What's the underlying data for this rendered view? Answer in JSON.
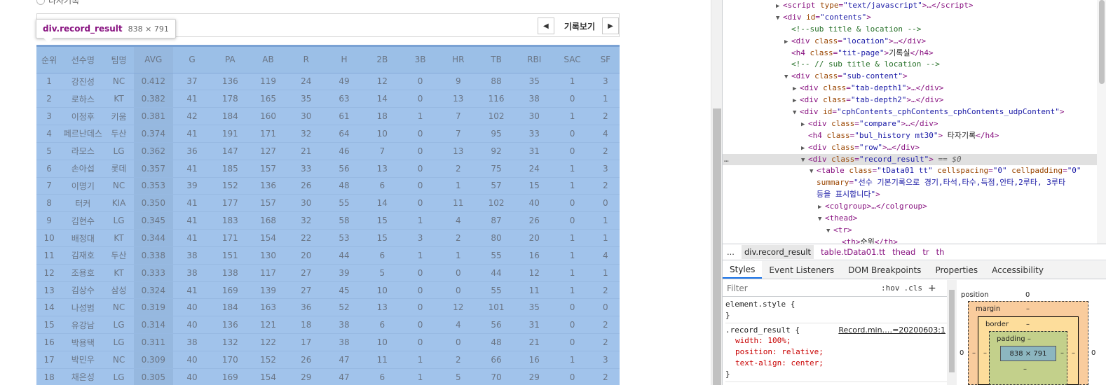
{
  "page": {
    "radio_label": "타자기록",
    "pager": {
      "label": "기록보기",
      "prev_icon": "◀",
      "next_icon": "▶"
    },
    "tooltip": {
      "tag": "div.record_result",
      "size": "838 × 791"
    }
  },
  "table": {
    "headers": [
      "순위",
      "선수명",
      "팀명",
      "AVG",
      "G",
      "PA",
      "AB",
      "R",
      "H",
      "2B",
      "3B",
      "HR",
      "TB",
      "RBI",
      "SAC",
      "SF"
    ],
    "rows": [
      [
        "1",
        "강진성",
        "NC",
        "0.412",
        "37",
        "136",
        "119",
        "24",
        "49",
        "12",
        "0",
        "9",
        "88",
        "35",
        "1",
        "3"
      ],
      [
        "2",
        "로하스",
        "KT",
        "0.382",
        "41",
        "178",
        "165",
        "35",
        "63",
        "14",
        "0",
        "13",
        "116",
        "38",
        "0",
        "1"
      ],
      [
        "3",
        "이정후",
        "키움",
        "0.381",
        "42",
        "184",
        "160",
        "30",
        "61",
        "18",
        "1",
        "7",
        "102",
        "30",
        "1",
        "2"
      ],
      [
        "4",
        "페르난데스",
        "두산",
        "0.374",
        "41",
        "191",
        "171",
        "32",
        "64",
        "10",
        "0",
        "7",
        "95",
        "33",
        "0",
        "4"
      ],
      [
        "5",
        "라모스",
        "LG",
        "0.362",
        "36",
        "147",
        "127",
        "21",
        "46",
        "7",
        "0",
        "13",
        "92",
        "31",
        "0",
        "2"
      ],
      [
        "6",
        "손아섭",
        "롯데",
        "0.357",
        "41",
        "185",
        "157",
        "33",
        "56",
        "13",
        "0",
        "2",
        "75",
        "24",
        "1",
        "3"
      ],
      [
        "7",
        "이명기",
        "NC",
        "0.353",
        "39",
        "152",
        "136",
        "26",
        "48",
        "6",
        "0",
        "1",
        "57",
        "15",
        "1",
        "2"
      ],
      [
        "8",
        "터커",
        "KIA",
        "0.350",
        "41",
        "177",
        "157",
        "30",
        "55",
        "14",
        "0",
        "11",
        "102",
        "40",
        "0",
        "0"
      ],
      [
        "9",
        "김현수",
        "LG",
        "0.345",
        "41",
        "183",
        "168",
        "32",
        "58",
        "15",
        "1",
        "4",
        "87",
        "26",
        "0",
        "1"
      ],
      [
        "10",
        "배정대",
        "KT",
        "0.344",
        "41",
        "171",
        "154",
        "22",
        "53",
        "15",
        "3",
        "2",
        "80",
        "20",
        "1",
        "1"
      ],
      [
        "11",
        "김재호",
        "두산",
        "0.338",
        "38",
        "151",
        "130",
        "20",
        "44",
        "6",
        "1",
        "1",
        "55",
        "16",
        "1",
        "4"
      ],
      [
        "12",
        "조용호",
        "KT",
        "0.333",
        "38",
        "138",
        "117",
        "27",
        "39",
        "5",
        "0",
        "0",
        "44",
        "12",
        "1",
        "1"
      ],
      [
        "13",
        "김상수",
        "삼성",
        "0.324",
        "41",
        "169",
        "139",
        "27",
        "45",
        "10",
        "0",
        "0",
        "55",
        "11",
        "1",
        "2"
      ],
      [
        "14",
        "나성범",
        "NC",
        "0.319",
        "40",
        "184",
        "163",
        "36",
        "52",
        "13",
        "0",
        "12",
        "101",
        "35",
        "0",
        "0"
      ],
      [
        "15",
        "유강남",
        "LG",
        "0.314",
        "40",
        "136",
        "121",
        "18",
        "38",
        "6",
        "0",
        "4",
        "56",
        "31",
        "0",
        "2"
      ],
      [
        "16",
        "박용택",
        "LG",
        "0.311",
        "38",
        "132",
        "122",
        "17",
        "38",
        "10",
        "0",
        "0",
        "48",
        "21",
        "0",
        "2"
      ],
      [
        "17",
        "박민우",
        "NC",
        "0.309",
        "40",
        "170",
        "152",
        "26",
        "47",
        "11",
        "1",
        "2",
        "66",
        "16",
        "1",
        "3"
      ],
      [
        "18",
        "채은성",
        "LG",
        "0.305",
        "40",
        "169",
        "154",
        "29",
        "47",
        "6",
        "1",
        "5",
        "70",
        "29",
        "0",
        "2"
      ]
    ]
  },
  "devtools": {
    "dom_lines": [
      {
        "indent": 0,
        "tri": "▶",
        "html": "<span>&lt;script </span><span class='attr'>type</span>=<span class='val'>\"text/javascript\"</span>&gt;…&lt;/script&gt;"
      },
      {
        "indent": 0,
        "tri": "▼",
        "html": "&lt;div <span class='attr'>id</span>=<span class='val'>\"contents\"</span>&gt;"
      },
      {
        "indent": 1,
        "tri": "",
        "html": "<span class='cmt'>&lt;!--sub title &amp; location --&gt;</span>"
      },
      {
        "indent": 1,
        "tri": "▶",
        "html": "&lt;div <span class='attr'>class</span>=<span class='val'>\"location\"</span>&gt;…&lt;/div&gt;"
      },
      {
        "indent": 1,
        "tri": "",
        "html": "&lt;h4 <span class='attr'>class</span>=<span class='val'>\"tit-page\"</span>&gt;<span class='txt'>기록실</span>&lt;/h4&gt;"
      },
      {
        "indent": 1,
        "tri": "",
        "html": "<span class='cmt'>&lt;!-- // sub title &amp; location --&gt;</span>"
      },
      {
        "indent": 1,
        "tri": "▼",
        "html": "&lt;div <span class='attr'>class</span>=<span class='val'>\"sub-content\"</span>&gt;"
      },
      {
        "indent": 2,
        "tri": "▶",
        "html": "&lt;div <span class='attr'>class</span>=<span class='val'>\"tab-depth1\"</span>&gt;…&lt;/div&gt;"
      },
      {
        "indent": 2,
        "tri": "▶",
        "html": "&lt;div <span class='attr'>class</span>=<span class='val'>\"tab-depth2\"</span>&gt;…&lt;/div&gt;"
      },
      {
        "indent": 2,
        "tri": "▼",
        "html": "&lt;div <span class='attr'>id</span>=<span class='val'>\"cphContents_cphContents_cphContents_udpContent\"</span>&gt;"
      },
      {
        "indent": 3,
        "tri": "▶",
        "html": "&lt;div <span class='attr'>class</span>=<span class='val'>\"compare\"</span>&gt;…&lt;/div&gt;"
      },
      {
        "indent": 3,
        "tri": "",
        "html": "&lt;h4 <span class='attr'>class</span>=<span class='val'>\"bul_history mt30\"</span>&gt; <span class='txt'>타자기록</span>&lt;/h4&gt;"
      },
      {
        "indent": 3,
        "tri": "▶",
        "html": "&lt;div <span class='attr'>class</span>=<span class='val'>\"row\"</span>&gt;…&lt;/div&gt;"
      },
      {
        "indent": 3,
        "tri": "▼",
        "sel": true,
        "html": "&lt;div <span class='attr'>class</span>=<span class='val'>\"record_result\"</span>&gt; <span class='dollar'>== $0</span>"
      },
      {
        "indent": 4,
        "tri": "▼",
        "html": "&lt;table <span class='attr'>class</span>=<span class='val'>\"tData01 tt\"</span> <span class='attr'>cellspacing</span>=<span class='val'>\"0\"</span> <span class='attr'>cellpadding</span>=<span class='val'>\"0\"</span>"
      },
      {
        "indent": 4,
        "tri": "",
        "html": "<span class='attr'>summary</span>=<span class='val'>\"선수 기본기록으로 경기,타석,타수,득점,안타,2루타, 3루타</span>"
      },
      {
        "indent": 4,
        "tri": "",
        "html": "<span class='val'>등을 표시합니다\"</span>&gt;"
      },
      {
        "indent": 5,
        "tri": "▶",
        "html": "&lt;colgroup&gt;…&lt;/colgroup&gt;"
      },
      {
        "indent": 5,
        "tri": "▼",
        "html": "&lt;thead&gt;"
      },
      {
        "indent": 6,
        "tri": "▼",
        "html": "&lt;tr&gt;"
      },
      {
        "indent": 7,
        "tri": "",
        "html": "&lt;th&gt;<span class='txt'>순위</span>&lt;/th&gt;"
      }
    ],
    "crumbs": {
      "ellipsis": "...",
      "items": [
        "div.record_result",
        "table.tData01.tt",
        "thead",
        "tr",
        "th"
      ]
    },
    "tabs": [
      "Styles",
      "Event Listeners",
      "DOM Breakpoints",
      "Properties",
      "Accessibility"
    ],
    "filter": {
      "placeholder": "Filter",
      "hov": ":hov",
      "cls": ".cls",
      "plus": "+"
    },
    "styles": {
      "element_style_open": "element.style {",
      "close": "}",
      "rule_selector": ".record_result {",
      "rule_source": "Record.min.…=20200603:1",
      "props": [
        "width: 100%;",
        "position: relative;",
        "text-align: center;"
      ],
      "next_source": "Record.min.…=20200603:1"
    },
    "boxmodel": {
      "position_label": "position",
      "position_value": "0",
      "margin_label": "margin",
      "margin_value": "–",
      "border_label": "border",
      "border_value": "–",
      "padding_label": "padding –",
      "content": "838 × 791",
      "side_left": "0",
      "side_right": "0",
      "inner_dash": "–"
    }
  }
}
